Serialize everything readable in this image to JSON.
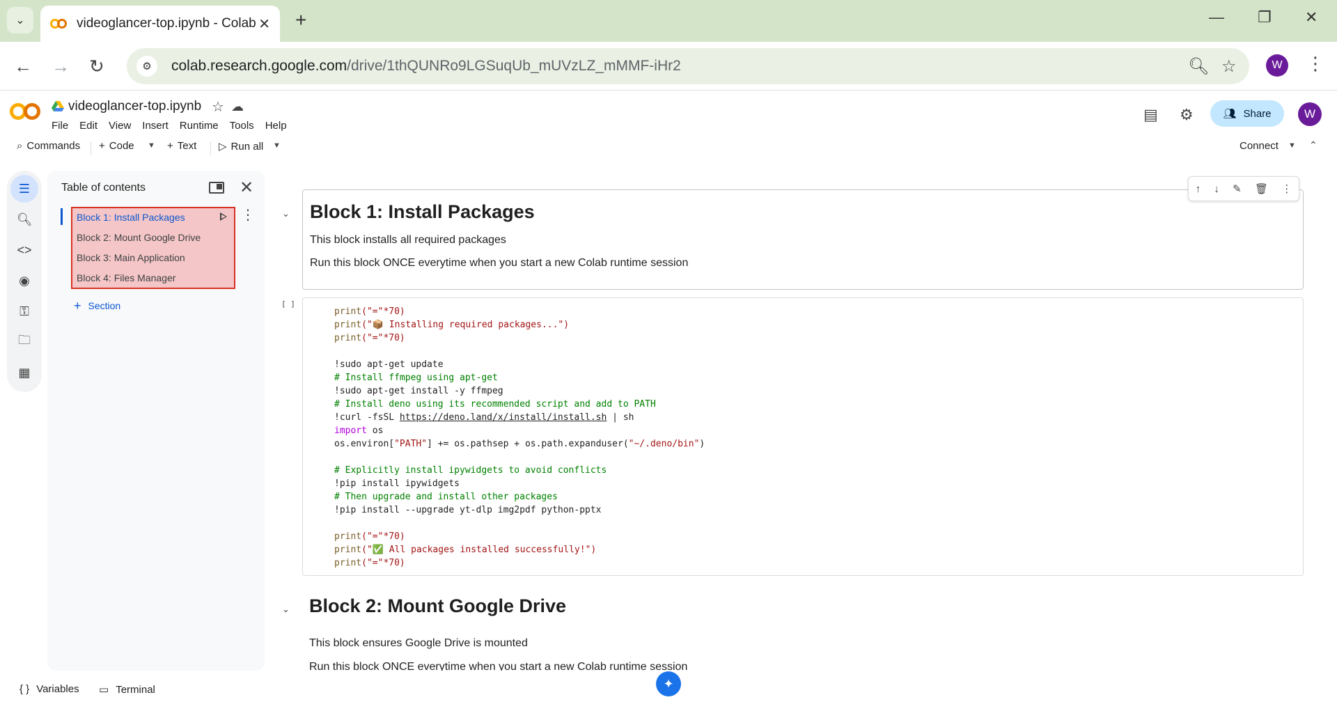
{
  "browser": {
    "tab_title": "videoglancer-top.ipynb - Colab",
    "url_host": "colab.research.google.com",
    "url_path": "/drive/1thQUNRo9LGSuqUb_mUVzLZ_mMMF-iHr2",
    "profile_initial": "W"
  },
  "colab": {
    "notebook_name": "videoglancer-top.ipynb",
    "menu": [
      "File",
      "Edit",
      "View",
      "Insert",
      "Runtime",
      "Tools",
      "Help"
    ],
    "share_label": "Share",
    "avatar_initial": "W",
    "commands": {
      "commands_label": "Commands",
      "code_label": "Code",
      "text_label": "Text",
      "run_all_label": "Run all",
      "connect_label": "Connect"
    }
  },
  "toc": {
    "title": "Table of contents",
    "items": [
      "Block 1: Install Packages",
      "Block 2: Mount Google Drive",
      "Block 3: Main Application",
      "Block 4: Files Manager"
    ],
    "add_section_label": "Section"
  },
  "cells": {
    "block1_heading": "Block 1: Install Packages",
    "block1_p1": "This block installs all required packages",
    "block1_p2": "Run this block ONCE everytime when you start a new Colab runtime session",
    "code_gutter": "[ ]",
    "block2_heading": "Block 2: Mount Google Drive",
    "block2_p1": "This block ensures Google Drive is mounted",
    "block2_p2": "Run this block ONCE everytime when you start a new Colab runtime session"
  },
  "code_lines": {
    "l1_fn": "print",
    "l1_rest": "(\"=\"*70)",
    "l2_fn": "print",
    "l2_str": "(\"📦 Installing required packages...\")",
    "l3_fn": "print",
    "l3_rest": "(\"=\"*70)",
    "l4": "!sudo apt-get update",
    "l5": "# Install ffmpeg using apt-get",
    "l6": "!sudo apt-get install -y ffmpeg",
    "l7": "# Install deno using its recommended script and add to PATH",
    "l8_a": "!curl -fsSL ",
    "l8_link": "https://deno.land/x/install/install.sh",
    "l8_b": " | sh",
    "l9_kw": "import",
    "l9_rest": " os",
    "l10_a": "os.environ[",
    "l10_str": "\"PATH\"",
    "l10_b": "] += os.pathsep + os.path.expanduser(",
    "l10_str2": "\"~/.deno/bin\"",
    "l10_c": ")",
    "l11": "# Explicitly install ipywidgets to avoid conflicts",
    "l12": "!pip install ipywidgets",
    "l13": "# Then upgrade and install other packages",
    "l14": "!pip install --upgrade yt-dlp img2pdf python-pptx",
    "l15_fn": "print",
    "l15_rest": "(\"=\"*70)",
    "l16_fn": "print",
    "l16_str": "(\"✅ All packages installed successfully!\")",
    "l17_fn": "print",
    "l17_rest": "(\"=\"*70)"
  },
  "status": {
    "variables_label": "Variables",
    "terminal_label": "Terminal"
  },
  "colors": {
    "tabbar_bg": "#d4e4c9",
    "accent_blue": "#0b57d0",
    "share_bg": "#c2e7ff",
    "toc_highlight": "#f5c6c7",
    "toc_highlight_border": "#d93025"
  }
}
